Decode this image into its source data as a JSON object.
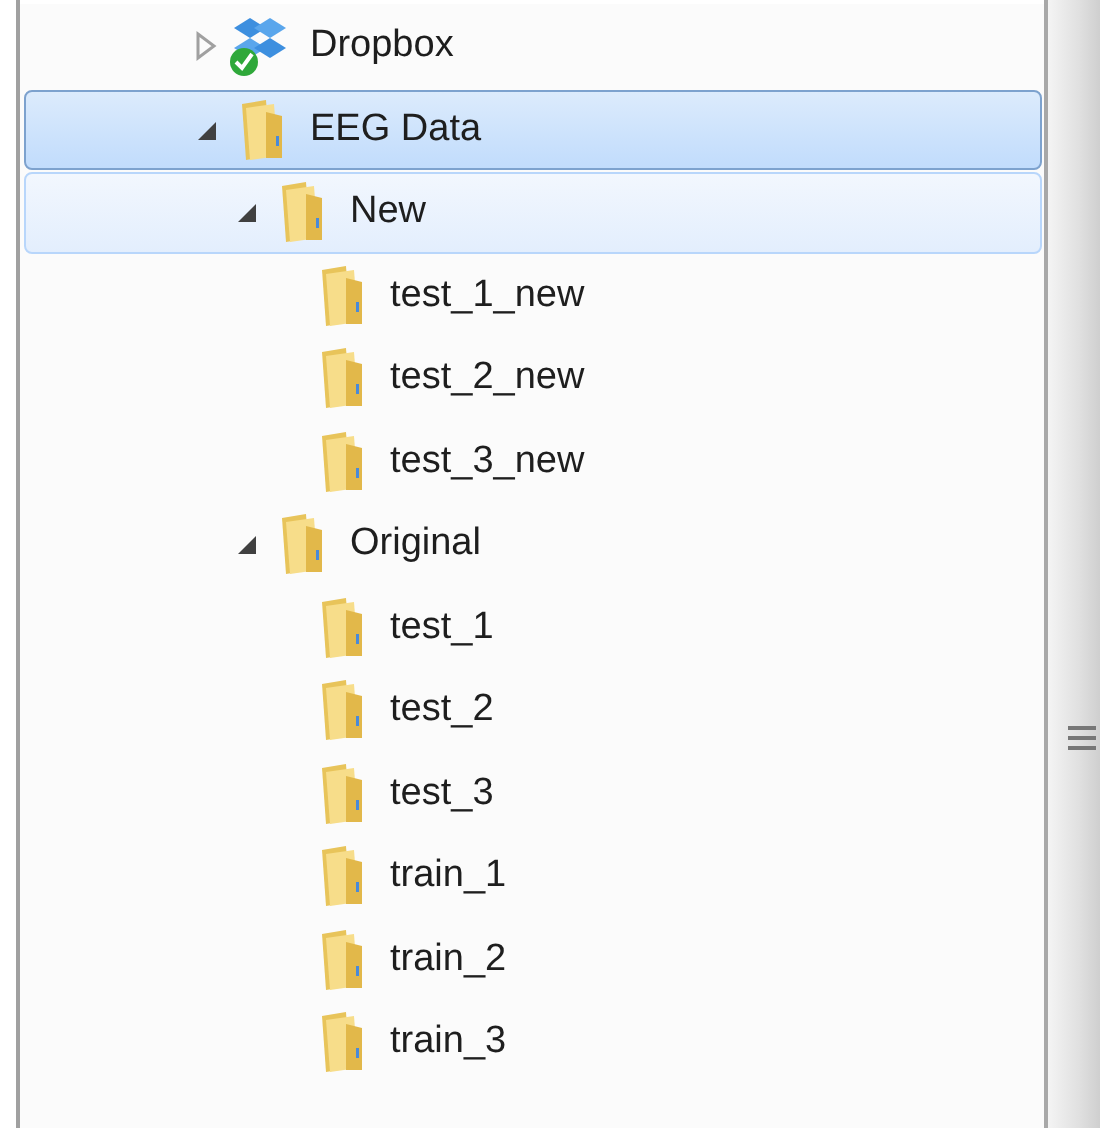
{
  "tree": [
    {
      "label": "Dropbox",
      "kind": "dropbox",
      "expanded": false,
      "selected": false,
      "hovered": false
    },
    {
      "label": "EEG Data",
      "kind": "folder",
      "expanded": true,
      "selected": true,
      "hovered": false,
      "children": [
        {
          "label": "New",
          "kind": "folder",
          "expanded": true,
          "selected": false,
          "hovered": true,
          "children": [
            {
              "label": "test_1_new",
              "kind": "folder",
              "selected": false,
              "hovered": false
            },
            {
              "label": "test_2_new",
              "kind": "folder",
              "selected": false,
              "hovered": false
            },
            {
              "label": "test_3_new",
              "kind": "folder",
              "selected": false,
              "hovered": false
            }
          ]
        },
        {
          "label": "Original",
          "kind": "folder",
          "expanded": true,
          "selected": false,
          "hovered": false,
          "children": [
            {
              "label": "test_1",
              "kind": "folder",
              "selected": false,
              "hovered": false
            },
            {
              "label": "test_2",
              "kind": "folder",
              "selected": false,
              "hovered": false
            },
            {
              "label": "test_3",
              "kind": "folder",
              "selected": false,
              "hovered": false
            },
            {
              "label": "train_1",
              "kind": "folder",
              "selected": false,
              "hovered": false
            },
            {
              "label": "train_2",
              "kind": "folder",
              "selected": false,
              "hovered": false
            },
            {
              "label": "train_3",
              "kind": "folder",
              "selected": false,
              "hovered": false
            }
          ]
        }
      ]
    }
  ]
}
